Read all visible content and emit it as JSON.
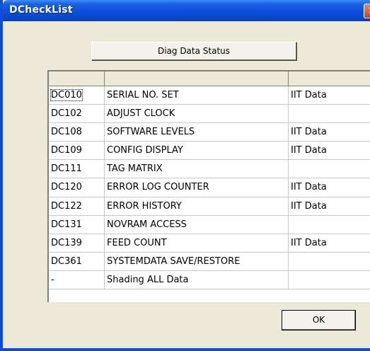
{
  "window": {
    "title": "DCheckList",
    "close_glyph": "✕"
  },
  "toolbar": {
    "diag_button_label": "Diag Data Status"
  },
  "list": {
    "columns": [
      "",
      "",
      ""
    ],
    "rows": [
      {
        "code": "DC010",
        "name": "SERIAL NO. SET",
        "status": "IIT Data",
        "selected": true
      },
      {
        "code": "DC102",
        "name": "ADJUST CLOCK",
        "status": ""
      },
      {
        "code": "DC108",
        "name": "SOFTWARE LEVELS",
        "status": "IIT Data"
      },
      {
        "code": "DC109",
        "name": "CONFIG DISPLAY",
        "status": "IIT Data"
      },
      {
        "code": "DC111",
        "name": "TAG MATRIX",
        "status": ""
      },
      {
        "code": "DC120",
        "name": "ERROR LOG COUNTER",
        "status": "IIT Data"
      },
      {
        "code": "DC122",
        "name": "ERROR HISTORY",
        "status": "IIT Data"
      },
      {
        "code": "DC131",
        "name": "NOVRAM ACCESS",
        "status": ""
      },
      {
        "code": "DC139",
        "name": "FEED COUNT",
        "status": "IIT Data"
      },
      {
        "code": "DC361",
        "name": "SYSTEMDATA SAVE/RESTORE",
        "status": ""
      },
      {
        "code": "-",
        "name": "Shading ALL Data",
        "status": ""
      }
    ]
  },
  "footer": {
    "ok_label": "OK"
  }
}
